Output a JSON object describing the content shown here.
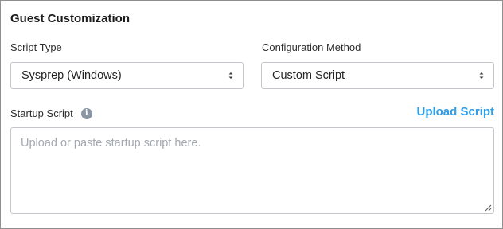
{
  "section": {
    "title": "Guest Customization"
  },
  "script_type": {
    "label": "Script Type",
    "value": "Sysprep (Windows)"
  },
  "configuration_method": {
    "label": "Configuration Method",
    "value": "Custom Script"
  },
  "startup_script": {
    "label": "Startup Script",
    "info_icon": "info-icon",
    "upload_link": "Upload Script",
    "placeholder": "Upload or paste startup script here.",
    "value": ""
  },
  "colors": {
    "link": "#2e9ee6",
    "info_icon_bg": "#8a96a3",
    "border": "#c3c7cc"
  }
}
